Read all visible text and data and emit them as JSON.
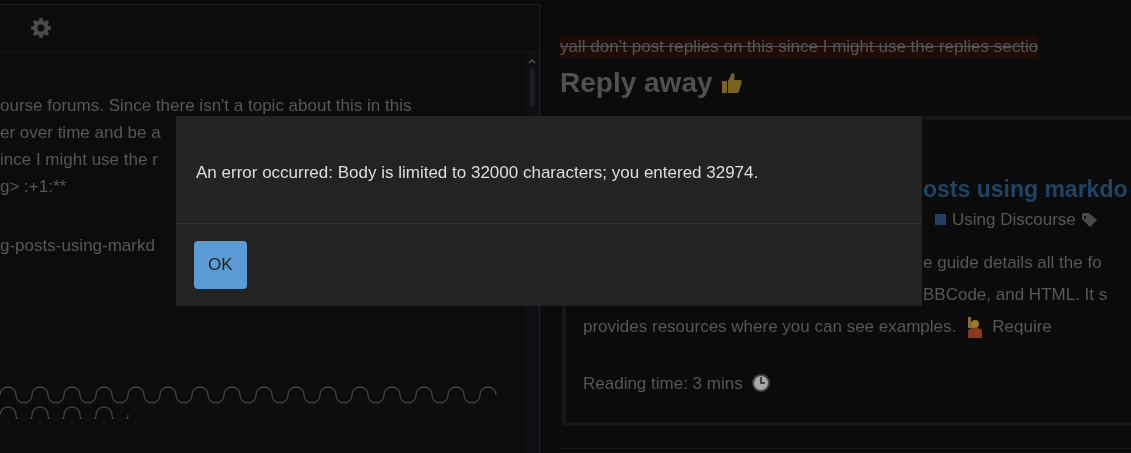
{
  "editor": {
    "visible_text": [
      "ourse forums. Since there isn't a topic about this in this",
      "er over time and be a",
      "ince I might use the r",
      "g> :+1:**",
      "g-posts-using-markd"
    ]
  },
  "preview": {
    "struck_line": "yall don’t post replies on this since I might use the replies sectio",
    "heading": "Reply away",
    "onebox": {
      "title": "osts using markdo",
      "category": {
        "name": "Using Discourse",
        "color": "#1f3f66"
      },
      "excerpt": [
        "e guide details all the fo",
        "BBCode, and HTML. It s",
        "provides resources where you can see examples."
      ],
      "excerpt_tail": "Require",
      "reading_time": "Reading time: 3 mins"
    }
  },
  "dialog": {
    "message": "An error occurred: Body is limited to 32000 characters; you entered 32974.",
    "buttons": [
      "OK"
    ]
  }
}
